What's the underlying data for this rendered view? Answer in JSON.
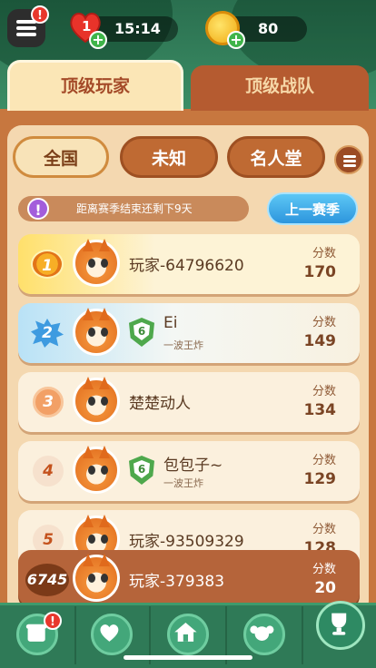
{
  "header": {
    "lives": "1",
    "timer": "15:14",
    "coins": "80",
    "menu_badge": "!",
    "plus": "+"
  },
  "tabs": [
    {
      "label": "顶级玩家",
      "selected": true
    },
    {
      "label": "顶级战队",
      "selected": false
    }
  ],
  "filters": [
    {
      "label": "全国",
      "selected": true
    },
    {
      "label": "未知",
      "selected": false
    },
    {
      "label": "名人堂",
      "selected": false
    }
  ],
  "notice": {
    "icon": "!",
    "text": "距离赛季结束还剩下9天",
    "prev_season": "上一赛季"
  },
  "score_label": "分数",
  "rows": [
    {
      "rank": "1",
      "name": "玩家-64796620",
      "team": "",
      "team_badge": "",
      "score": "170"
    },
    {
      "rank": "2",
      "name": "Ei",
      "team": "一波王炸",
      "team_badge": "6",
      "score": "149"
    },
    {
      "rank": "3",
      "name": "楚楚动人",
      "team": "",
      "team_badge": "",
      "score": "134"
    },
    {
      "rank": "4",
      "name": "包包子~",
      "team": "一波王炸",
      "team_badge": "6",
      "score": "129"
    },
    {
      "rank": "5",
      "name": "玩家-93509329",
      "team": "",
      "team_badge": "",
      "score": "128"
    }
  ],
  "me": {
    "rank": "6745",
    "name": "玩家-379383",
    "score": "20"
  },
  "bottom_nav": {
    "badge": "!",
    "items": [
      "shop-icon",
      "heart-icon",
      "home-icon",
      "team-icon",
      "trophy-icon"
    ],
    "selected": "trophy-icon"
  }
}
